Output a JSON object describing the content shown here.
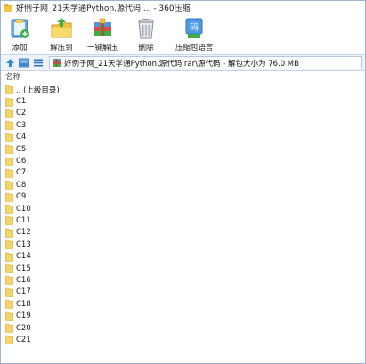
{
  "window": {
    "title": "好例子网_21天学通Python.源代码.... - 360压缩"
  },
  "toolbar": {
    "buttons": [
      {
        "label": "添加",
        "icon": "add-icon"
      },
      {
        "label": "解压到",
        "icon": "extract-to-icon"
      },
      {
        "label": "一键解压",
        "icon": "one-click-extract-icon"
      },
      {
        "label": "删除",
        "icon": "trash-icon"
      },
      {
        "label": "压缩包语言",
        "icon": "archive-language-icon"
      }
    ]
  },
  "address": {
    "path": "好例子网_21天学通Python.源代码.rar\\源代码 - 解包大小为 76.0 MB"
  },
  "list": {
    "column_header": "名称",
    "items": [
      ".. (上级目录)",
      "C1",
      "C2",
      "C3",
      "C4",
      "C5",
      "C6",
      "C7",
      "C8",
      "C9",
      "C10",
      "C11",
      "C12",
      "C13",
      "C14",
      "C15",
      "C16",
      "C17",
      "C18",
      "C19",
      "C20",
      "C21"
    ]
  },
  "colors": {
    "folder": "#f5d46b",
    "folder_edge": "#d9a928",
    "accent": "#2f6fc4"
  }
}
